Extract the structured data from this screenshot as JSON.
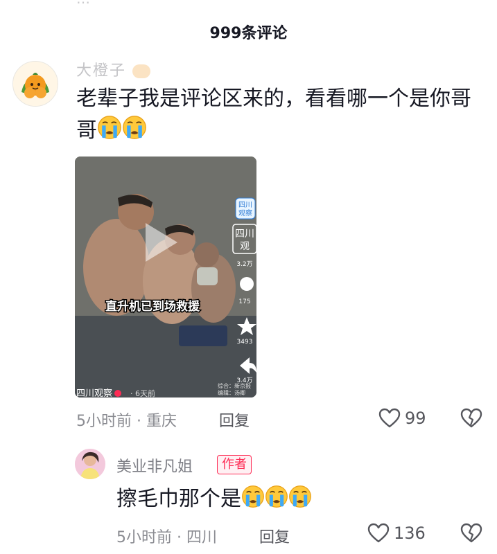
{
  "header": {
    "title": "999条评论"
  },
  "comments": [
    {
      "username": "大橙子",
      "text": "老辈子我是评论区来的，看看哪一个是你哥哥",
      "emojis": [
        "crying-face",
        "crying-face"
      ],
      "time": "5小时前",
      "location": "重庆",
      "reply_label": "回复",
      "likes": "99",
      "video": {
        "caption": "直升机已到场救援",
        "channel": "四川观察",
        "posted": "6天前",
        "logo_text": "四川 观察",
        "side_label": "四川 观",
        "side_counts": [
          "3.2万",
          "175",
          "3493",
          "3.4万"
        ],
        "credits": [
          "综合：新京报",
          "编辑：汤卿"
        ]
      }
    },
    {
      "username": "美业非凡姐",
      "badge": "作者",
      "text": "擦毛巾那个是",
      "emojis": [
        "crying-face",
        "crying-face",
        "crying-face"
      ],
      "time": "5小时前",
      "location": "四川",
      "reply_label": "回复",
      "likes": "136"
    }
  ],
  "colors": {
    "accent": "#fe2c55",
    "muted": "#8a8b91",
    "text": "#161823"
  }
}
